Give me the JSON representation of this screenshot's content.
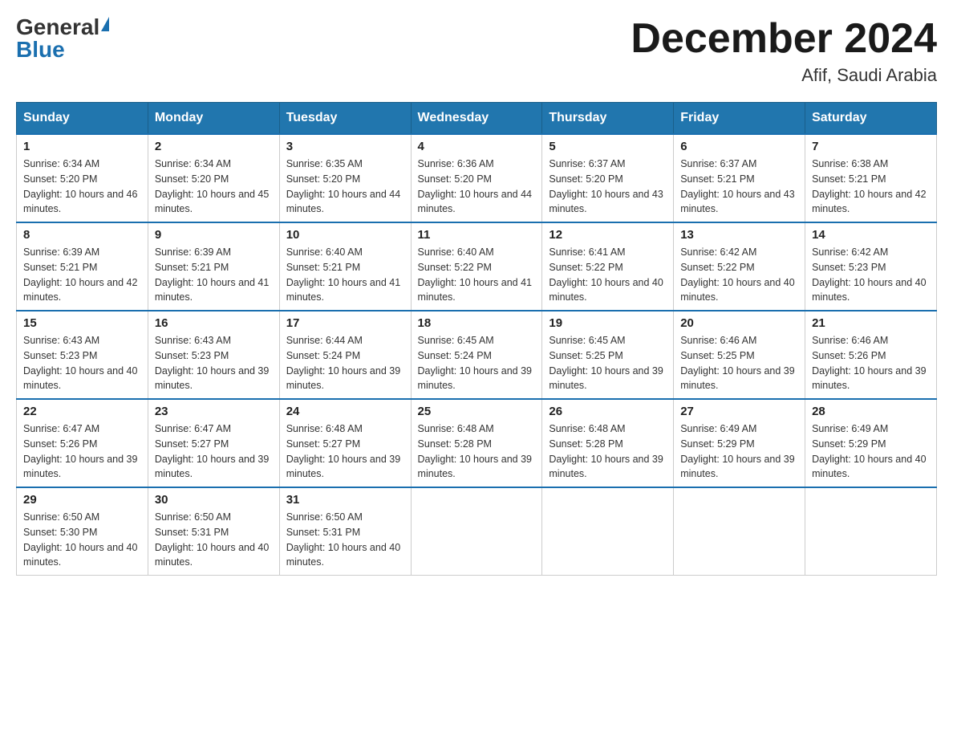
{
  "header": {
    "logo": {
      "general": "General",
      "blue": "Blue"
    },
    "title": "December 2024",
    "location": "Afif, Saudi Arabia"
  },
  "calendar": {
    "days_of_week": [
      "Sunday",
      "Monday",
      "Tuesday",
      "Wednesday",
      "Thursday",
      "Friday",
      "Saturday"
    ],
    "weeks": [
      [
        {
          "day": "1",
          "sunrise": "6:34 AM",
          "sunset": "5:20 PM",
          "daylight": "10 hours and 46 minutes."
        },
        {
          "day": "2",
          "sunrise": "6:34 AM",
          "sunset": "5:20 PM",
          "daylight": "10 hours and 45 minutes."
        },
        {
          "day": "3",
          "sunrise": "6:35 AM",
          "sunset": "5:20 PM",
          "daylight": "10 hours and 44 minutes."
        },
        {
          "day": "4",
          "sunrise": "6:36 AM",
          "sunset": "5:20 PM",
          "daylight": "10 hours and 44 minutes."
        },
        {
          "day": "5",
          "sunrise": "6:37 AM",
          "sunset": "5:20 PM",
          "daylight": "10 hours and 43 minutes."
        },
        {
          "day": "6",
          "sunrise": "6:37 AM",
          "sunset": "5:21 PM",
          "daylight": "10 hours and 43 minutes."
        },
        {
          "day": "7",
          "sunrise": "6:38 AM",
          "sunset": "5:21 PM",
          "daylight": "10 hours and 42 minutes."
        }
      ],
      [
        {
          "day": "8",
          "sunrise": "6:39 AM",
          "sunset": "5:21 PM",
          "daylight": "10 hours and 42 minutes."
        },
        {
          "day": "9",
          "sunrise": "6:39 AM",
          "sunset": "5:21 PM",
          "daylight": "10 hours and 41 minutes."
        },
        {
          "day": "10",
          "sunrise": "6:40 AM",
          "sunset": "5:21 PM",
          "daylight": "10 hours and 41 minutes."
        },
        {
          "day": "11",
          "sunrise": "6:40 AM",
          "sunset": "5:22 PM",
          "daylight": "10 hours and 41 minutes."
        },
        {
          "day": "12",
          "sunrise": "6:41 AM",
          "sunset": "5:22 PM",
          "daylight": "10 hours and 40 minutes."
        },
        {
          "day": "13",
          "sunrise": "6:42 AM",
          "sunset": "5:22 PM",
          "daylight": "10 hours and 40 minutes."
        },
        {
          "day": "14",
          "sunrise": "6:42 AM",
          "sunset": "5:23 PM",
          "daylight": "10 hours and 40 minutes."
        }
      ],
      [
        {
          "day": "15",
          "sunrise": "6:43 AM",
          "sunset": "5:23 PM",
          "daylight": "10 hours and 40 minutes."
        },
        {
          "day": "16",
          "sunrise": "6:43 AM",
          "sunset": "5:23 PM",
          "daylight": "10 hours and 39 minutes."
        },
        {
          "day": "17",
          "sunrise": "6:44 AM",
          "sunset": "5:24 PM",
          "daylight": "10 hours and 39 minutes."
        },
        {
          "day": "18",
          "sunrise": "6:45 AM",
          "sunset": "5:24 PM",
          "daylight": "10 hours and 39 minutes."
        },
        {
          "day": "19",
          "sunrise": "6:45 AM",
          "sunset": "5:25 PM",
          "daylight": "10 hours and 39 minutes."
        },
        {
          "day": "20",
          "sunrise": "6:46 AM",
          "sunset": "5:25 PM",
          "daylight": "10 hours and 39 minutes."
        },
        {
          "day": "21",
          "sunrise": "6:46 AM",
          "sunset": "5:26 PM",
          "daylight": "10 hours and 39 minutes."
        }
      ],
      [
        {
          "day": "22",
          "sunrise": "6:47 AM",
          "sunset": "5:26 PM",
          "daylight": "10 hours and 39 minutes."
        },
        {
          "day": "23",
          "sunrise": "6:47 AM",
          "sunset": "5:27 PM",
          "daylight": "10 hours and 39 minutes."
        },
        {
          "day": "24",
          "sunrise": "6:48 AM",
          "sunset": "5:27 PM",
          "daylight": "10 hours and 39 minutes."
        },
        {
          "day": "25",
          "sunrise": "6:48 AM",
          "sunset": "5:28 PM",
          "daylight": "10 hours and 39 minutes."
        },
        {
          "day": "26",
          "sunrise": "6:48 AM",
          "sunset": "5:28 PM",
          "daylight": "10 hours and 39 minutes."
        },
        {
          "day": "27",
          "sunrise": "6:49 AM",
          "sunset": "5:29 PM",
          "daylight": "10 hours and 39 minutes."
        },
        {
          "day": "28",
          "sunrise": "6:49 AM",
          "sunset": "5:29 PM",
          "daylight": "10 hours and 40 minutes."
        }
      ],
      [
        {
          "day": "29",
          "sunrise": "6:50 AM",
          "sunset": "5:30 PM",
          "daylight": "10 hours and 40 minutes."
        },
        {
          "day": "30",
          "sunrise": "6:50 AM",
          "sunset": "5:31 PM",
          "daylight": "10 hours and 40 minutes."
        },
        {
          "day": "31",
          "sunrise": "6:50 AM",
          "sunset": "5:31 PM",
          "daylight": "10 hours and 40 minutes."
        },
        null,
        null,
        null,
        null
      ]
    ]
  }
}
